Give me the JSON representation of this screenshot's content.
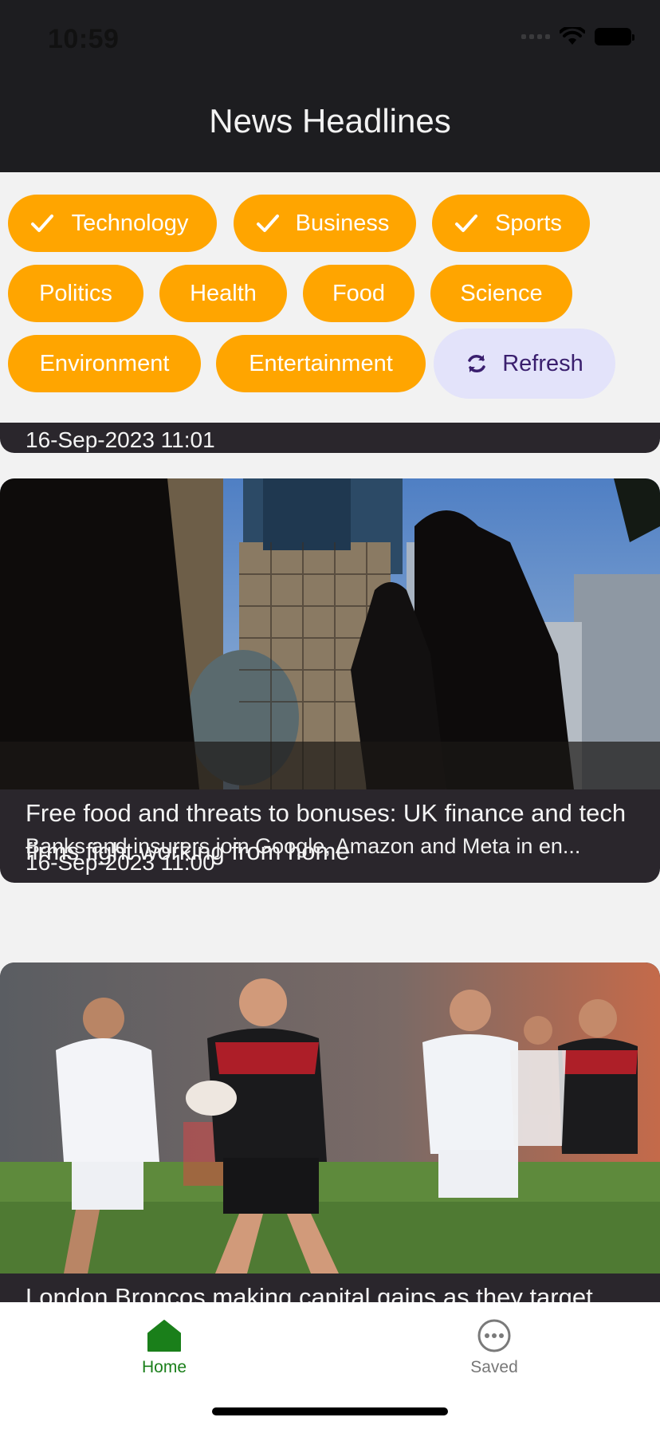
{
  "status_bar": {
    "time": "10:59"
  },
  "app_bar": {
    "title": "News Headlines"
  },
  "categories": [
    {
      "label": "Technology",
      "selected": true
    },
    {
      "label": "Business",
      "selected": true
    },
    {
      "label": "Sports",
      "selected": true
    },
    {
      "label": "Politics",
      "selected": false
    },
    {
      "label": "Health",
      "selected": false
    },
    {
      "label": "Food",
      "selected": false
    },
    {
      "label": "Science",
      "selected": false
    },
    {
      "label": "Environment",
      "selected": false
    },
    {
      "label": "Entertainment",
      "selected": false
    }
  ],
  "refresh_button": {
    "label": "Refresh",
    "icon": "refresh-icon"
  },
  "articles": [
    {
      "date": "16-Sep-2023 11:01"
    },
    {
      "title": "Free food and threats to bonuses: UK finance and tech firms fight working from home",
      "description": "Banks and insurers join Google, Amazon and Meta in en...",
      "date": "16-Sep-2023 11:00",
      "image": "city-commuters-silhouette-image"
    },
    {
      "title": "London Broncos making capital gains as they target",
      "image": "rugby-players-running-image"
    }
  ],
  "bottom_nav": {
    "tabs": [
      {
        "label": "Home",
        "icon": "home-icon",
        "active": true
      },
      {
        "label": "Saved",
        "icon": "more-circle-icon",
        "active": false
      }
    ]
  },
  "colors": {
    "chip": "#ffa500",
    "app_bar": "#1d1d20",
    "card": "#2a262c",
    "refresh_bg": "#e3e3fa",
    "active_tab": "#1a7f1a",
    "inactive_tab": "#777777"
  }
}
